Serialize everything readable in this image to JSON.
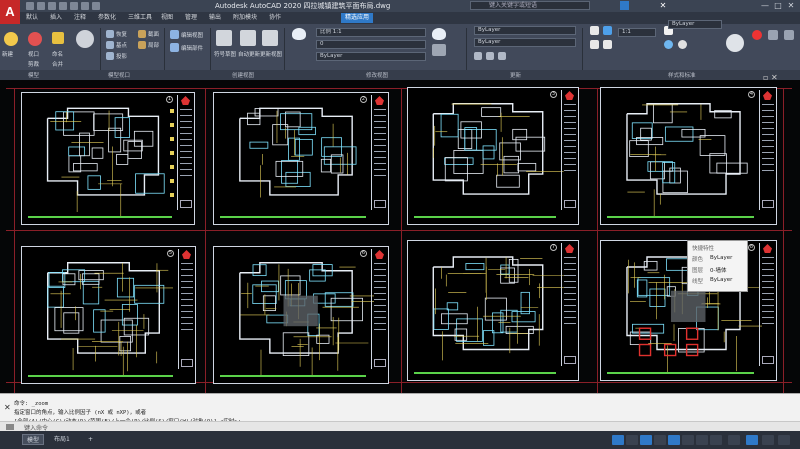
{
  "window": {
    "app_logo": "A",
    "title": "Autodesk AutoCAD 2020   四拉城镇建筑平面布局.dwg",
    "search_placeholder": "键入关键字或短语",
    "controls": [
      "—",
      "□",
      "✕"
    ]
  },
  "menu": {
    "tabs": [
      {
        "label": "默认",
        "active": false
      },
      {
        "label": "插入",
        "active": false
      },
      {
        "label": "注释",
        "active": false
      },
      {
        "label": "参数化",
        "active": false
      },
      {
        "label": "三维工具",
        "active": false
      },
      {
        "label": "视图",
        "active": false
      },
      {
        "label": "管理",
        "active": false
      },
      {
        "label": "输出",
        "active": false
      },
      {
        "label": "附加模块",
        "active": false
      },
      {
        "label": "协作",
        "active": false
      },
      {
        "label": "精选应用",
        "active": true
      }
    ]
  },
  "ribbon": {
    "panels": [
      "模型",
      "模型视口",
      "创建视图",
      "修改视图",
      "更新",
      "样式和标准"
    ],
    "buttons": {
      "new_layout": "新建",
      "layout_mode": "视口",
      "named": "命名",
      "clip": "剪裁",
      "join": "合并",
      "restore": "恢复",
      "base": "基点",
      "projected": "投影",
      "section": "截面",
      "detail": "局部",
      "edit_view": "编辑视图",
      "edit_components": "编辑部件",
      "symbol": "符号草图",
      "auto_update": "自动更新",
      "update_view": "更新视图"
    },
    "fields": {
      "view_scale": "比例 1:1",
      "layer_combo": "0",
      "color_combo": "ByLayer",
      "linetype_combo": "ByLayer",
      "lineweight_combo": "ByLayer"
    }
  },
  "drawing": {
    "sheets": [
      {
        "id": "sheet-1",
        "number": "1"
      },
      {
        "id": "sheet-2",
        "number": "2"
      },
      {
        "id": "sheet-3",
        "number": "3"
      },
      {
        "id": "sheet-4",
        "number": "4"
      },
      {
        "id": "sheet-5",
        "number": "5"
      },
      {
        "id": "sheet-6",
        "number": "6"
      },
      {
        "id": "sheet-7",
        "number": "7"
      },
      {
        "id": "sheet-8",
        "number": "8"
      }
    ],
    "quick_properties": {
      "title": "快捷特性",
      "rows": [
        {
          "key": "颜色",
          "value": "ByLayer"
        },
        {
          "key": "图层",
          "value": "0-墙体"
        },
        {
          "key": "线型",
          "value": "ByLayer"
        }
      ]
    }
  },
  "command_line": {
    "lines": [
      "命令: _zoom",
      "指定窗口的角点，输入比例因子 (nX 或 nXP)，或者",
      "[全部(A)/中心(C)/动态(D)/范围(E)/上一个(P)/比例(S)/窗口(W)/对象(O)] <实时>:"
    ],
    "prompt": "键入命令"
  },
  "status_bar": {
    "tabs": [
      {
        "label": "模型",
        "active": true
      },
      {
        "label": "布局1",
        "active": false
      }
    ],
    "scale": "1:1"
  },
  "colors": {
    "accent": "#2f79c8",
    "ribbon": "#41495a",
    "canvas": "#050607",
    "frame": "#cfd6e2",
    "grid_red": "#8a1f28",
    "wall_cyan": "#7fe3ff",
    "wall_white": "#e8eef6",
    "yellow": "#e6d15a",
    "green": "#5bd24a",
    "highlight_red": "#e0312e"
  }
}
